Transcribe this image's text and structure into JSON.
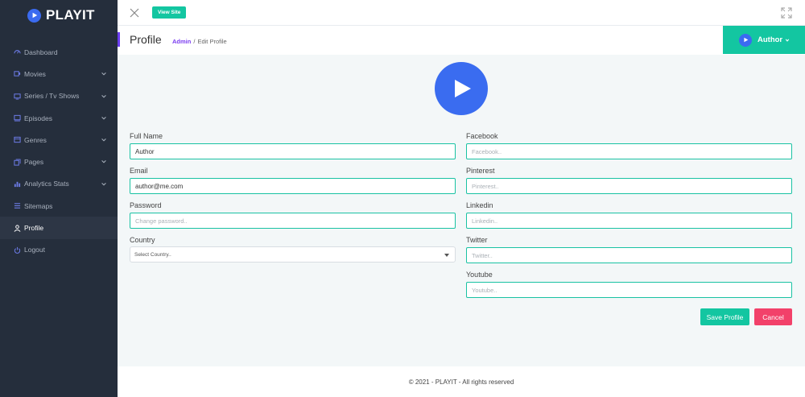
{
  "brand": {
    "name": "PLAYIT"
  },
  "sidebar": {
    "items": [
      {
        "label": "Dashboard",
        "icon": "dashboard-icon",
        "has_children": false,
        "active": false
      },
      {
        "label": "Movies",
        "icon": "film-icon",
        "has_children": true,
        "active": false
      },
      {
        "label": "Series / Tv Shows",
        "icon": "tv-icon",
        "has_children": true,
        "active": false
      },
      {
        "label": "Episodes",
        "icon": "episodes-icon",
        "has_children": true,
        "active": false
      },
      {
        "label": "Genres",
        "icon": "genres-icon",
        "has_children": true,
        "active": false
      },
      {
        "label": "Pages",
        "icon": "pages-icon",
        "has_children": true,
        "active": false
      },
      {
        "label": "Analytics Stats",
        "icon": "analytics-icon",
        "has_children": true,
        "active": false
      },
      {
        "label": "Sitemaps",
        "icon": "sitemap-icon",
        "has_children": false,
        "active": false
      },
      {
        "label": "Profile",
        "icon": "user-icon",
        "has_children": false,
        "active": true
      },
      {
        "label": "Logout",
        "icon": "power-icon",
        "has_children": false,
        "active": false
      }
    ]
  },
  "topbar": {
    "view_site_label": "View Site"
  },
  "header": {
    "title": "Profile",
    "breadcrumb": {
      "root": "Admin",
      "separator": "/",
      "current": "Edit Profile"
    },
    "user_label": "Author"
  },
  "form": {
    "full_name": {
      "label": "Full Name",
      "value": "Author"
    },
    "email": {
      "label": "Email",
      "value": "author@me.com"
    },
    "password": {
      "label": "Password",
      "placeholder": "Change password.."
    },
    "country": {
      "label": "Country",
      "selected": "Select Country.."
    },
    "facebook": {
      "label": "Facebook",
      "placeholder": "Facebook.."
    },
    "pinterest": {
      "label": "Pinterest",
      "placeholder": "Pinterest.."
    },
    "linkedin": {
      "label": "Linkedin",
      "placeholder": "Linkedin.."
    },
    "twitter": {
      "label": "Twitter",
      "placeholder": "Twitter.."
    },
    "youtube": {
      "label": "Youtube",
      "placeholder": "Youtube.."
    },
    "save_label": "Save Profile",
    "cancel_label": "Cancel"
  },
  "footer": {
    "text": "© 2021 - PLAYIT - All rights reserved"
  },
  "colors": {
    "accent": "#13c6a1",
    "primary": "#3a6cf0",
    "danger": "#f2416a",
    "sidebar": "#252e3c",
    "breadcrumb": "#7b3df0"
  }
}
